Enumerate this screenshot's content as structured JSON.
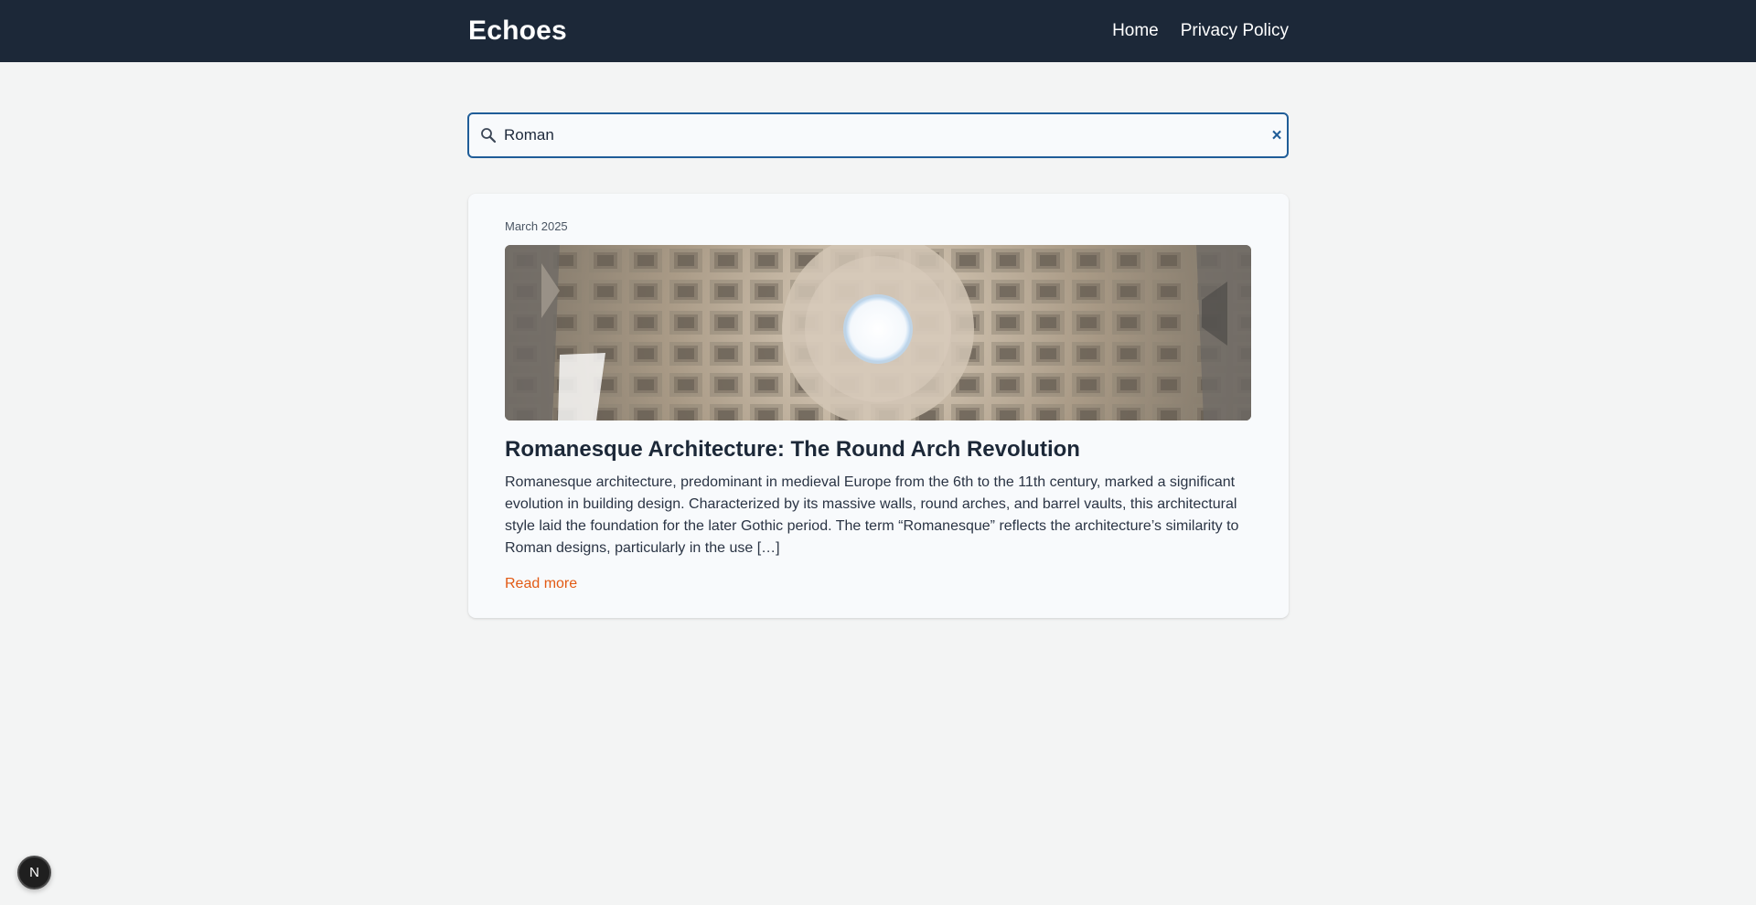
{
  "header": {
    "site_title": "Echoes",
    "nav": [
      {
        "label": "Home"
      },
      {
        "label": "Privacy Policy"
      }
    ]
  },
  "search": {
    "value": "Roman",
    "clear_label": "×"
  },
  "posts": [
    {
      "date": "March 2025",
      "image_alt": "Pantheon dome coffered ceiling with oculus",
      "title": "Romanesque Architecture: The Round Arch Revolution",
      "excerpt": "Romanesque architecture, predominant in medieval Europe from the 6th to the 11th century, marked a significant evolution in building design. Characterized by its massive walls, round arches, and barrel vaults, this architectural style laid the foundation for the later Gothic period. The term “Romanesque” reflects the architecture’s similarity to Roman designs, particularly in the use […]",
      "read_more": "Read more"
    }
  ],
  "dev_badge": {
    "label": "N"
  },
  "colors": {
    "header_bg": "#1c2838",
    "page_bg": "#f3f4f4",
    "accent": "#1f5d98",
    "link": "#e25a14"
  }
}
